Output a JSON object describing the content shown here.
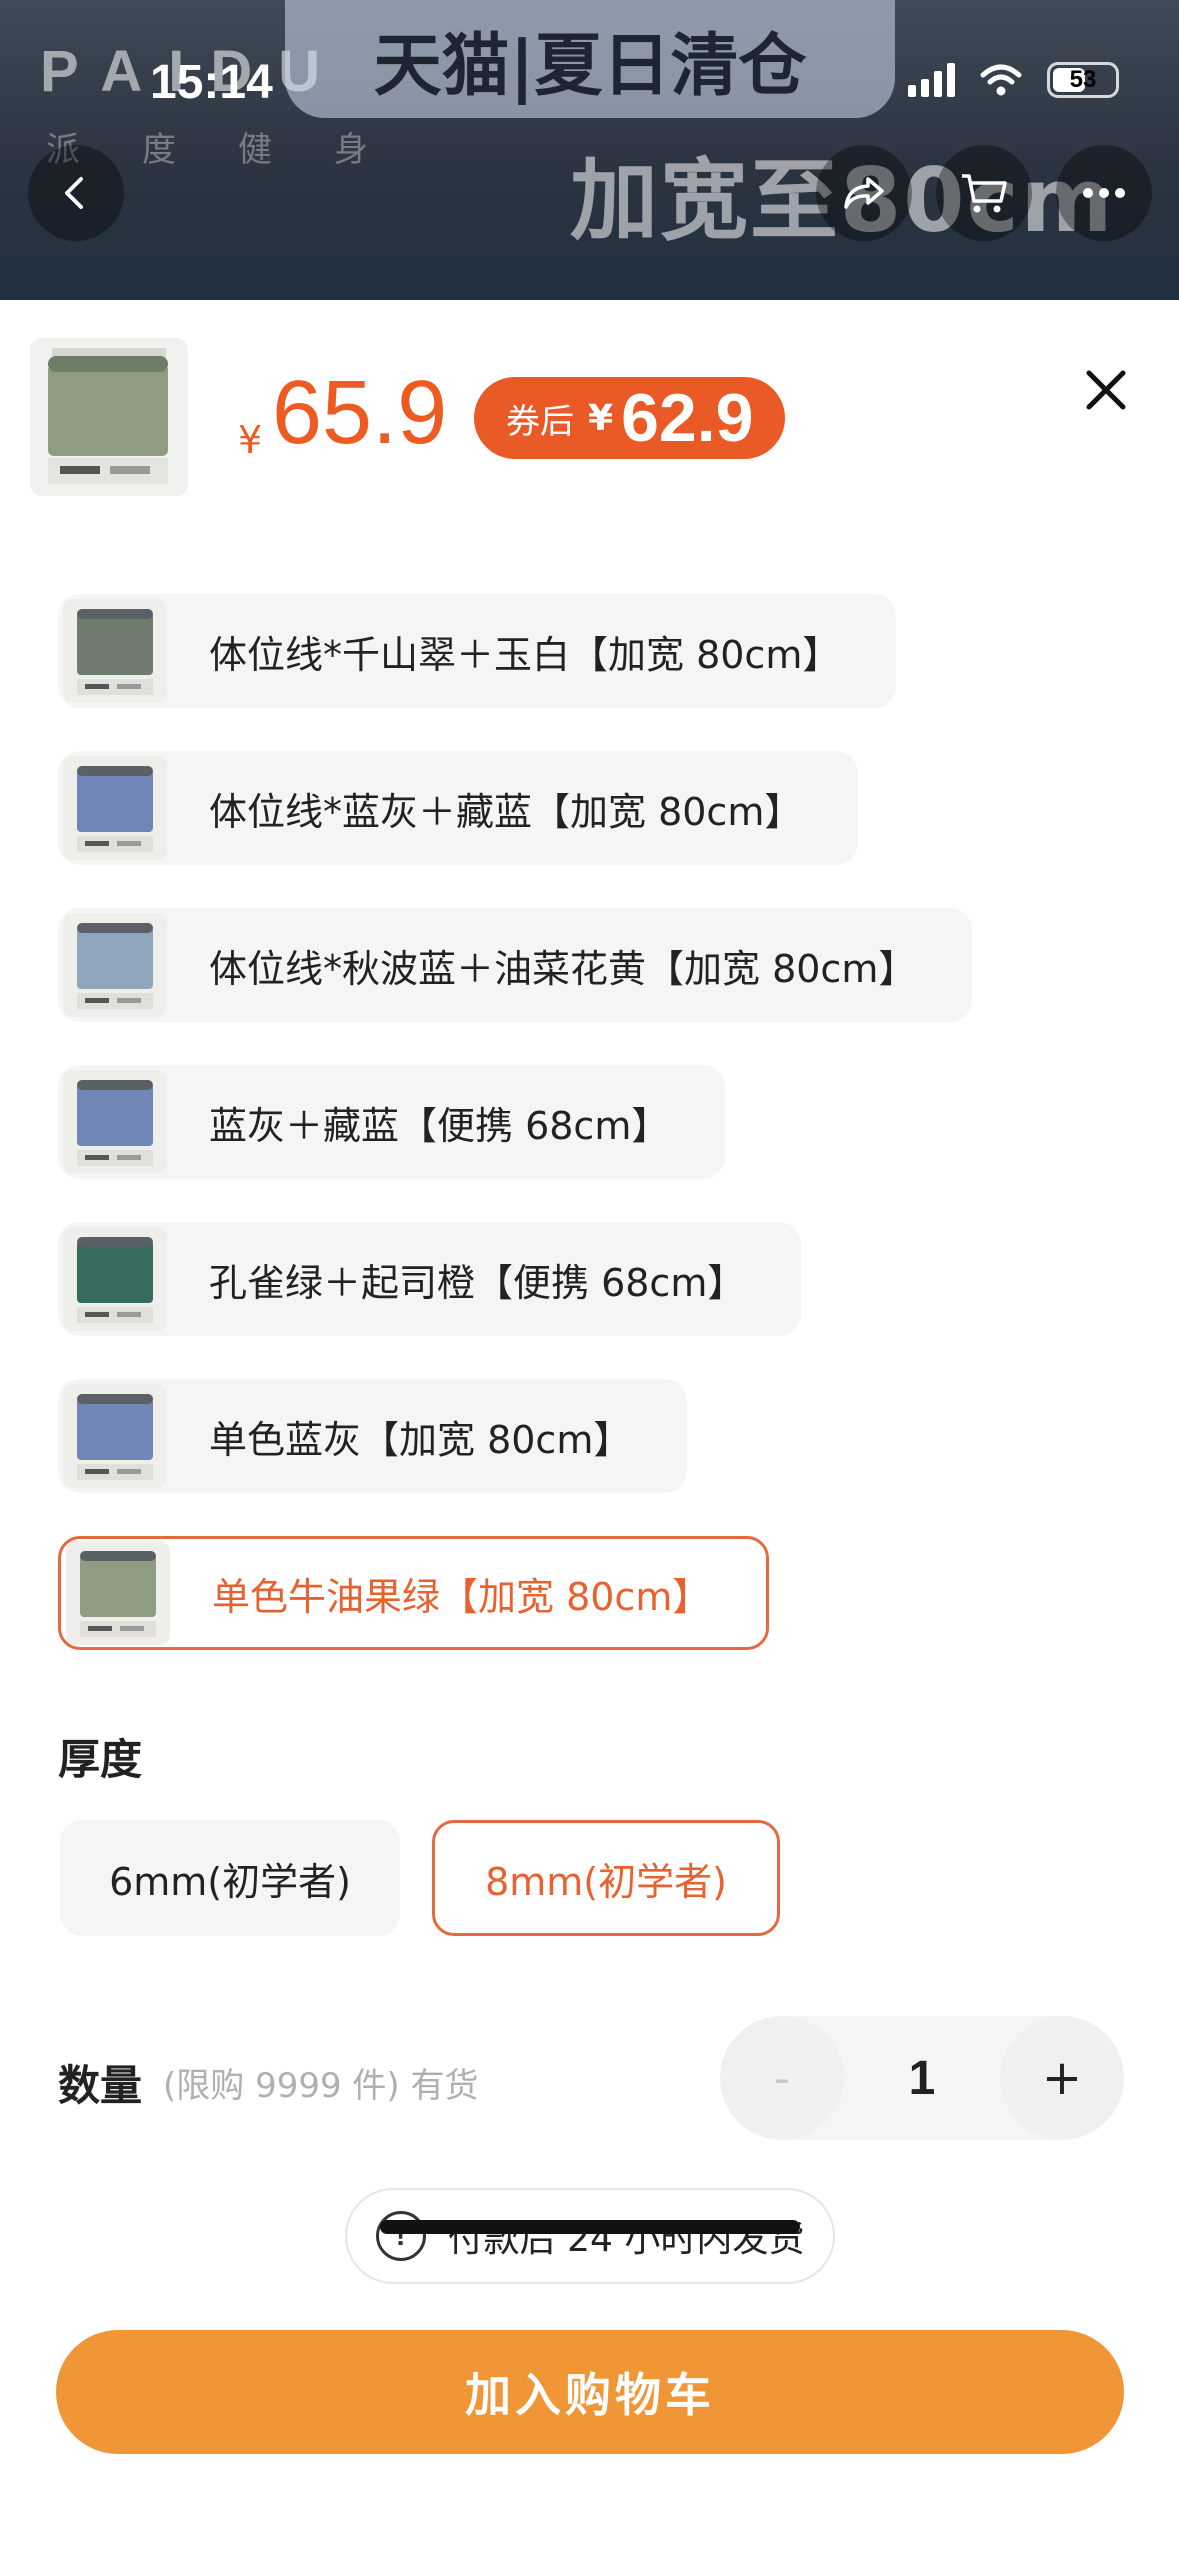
{
  "status_bar": {
    "time": "15:14",
    "battery": "53"
  },
  "background": {
    "brand": "PAIDU",
    "brand_sub": "派度健身",
    "banner": "天猫|夏日清仓",
    "promo": "加宽至80cm"
  },
  "sheet": {
    "price_currency": "¥",
    "price": "65.9",
    "coupon_label": "券后",
    "coupon_currency": "¥",
    "coupon_price": "62.9"
  },
  "variants": [
    {
      "label": "体位线*千山翠＋玉白【加宽 80cm】",
      "mat_color": "#6f7c6d",
      "selected": false
    },
    {
      "label": "体位线*蓝灰＋藏蓝【加宽 80cm】",
      "mat_color": "#6f86b6",
      "selected": false
    },
    {
      "label": "体位线*秋波蓝＋油菜花黄【加宽 80cm】",
      "mat_color": "#8fa4bd",
      "selected": false
    },
    {
      "label": "蓝灰＋藏蓝【便携 68cm】",
      "mat_color": "#6f86b6",
      "selected": false
    },
    {
      "label": "孔雀绿＋起司橙【便携 68cm】",
      "mat_color": "#356c5f",
      "selected": false
    },
    {
      "label": "单色蓝灰【加宽 80cm】",
      "mat_color": "#6f86b6",
      "selected": false
    },
    {
      "label": "单色牛油果绿【加宽 80cm】",
      "mat_color": "#8f9c84",
      "selected": true
    }
  ],
  "thickness": {
    "title": "厚度",
    "options": [
      {
        "label": "6mm(初学者)",
        "selected": false
      },
      {
        "label": "8mm(初学者)",
        "selected": true
      }
    ]
  },
  "quantity": {
    "label": "数量",
    "note": "(限购 9999 件) 有货",
    "value": "1",
    "minus": "-",
    "plus": "+"
  },
  "shipping_notice": "付款后 24 小时内发货",
  "add_to_cart": "加入购物车",
  "colors": {
    "accent": "#ee5b22",
    "cart_button": "#f09637",
    "selected_border": "#e66a3f"
  }
}
